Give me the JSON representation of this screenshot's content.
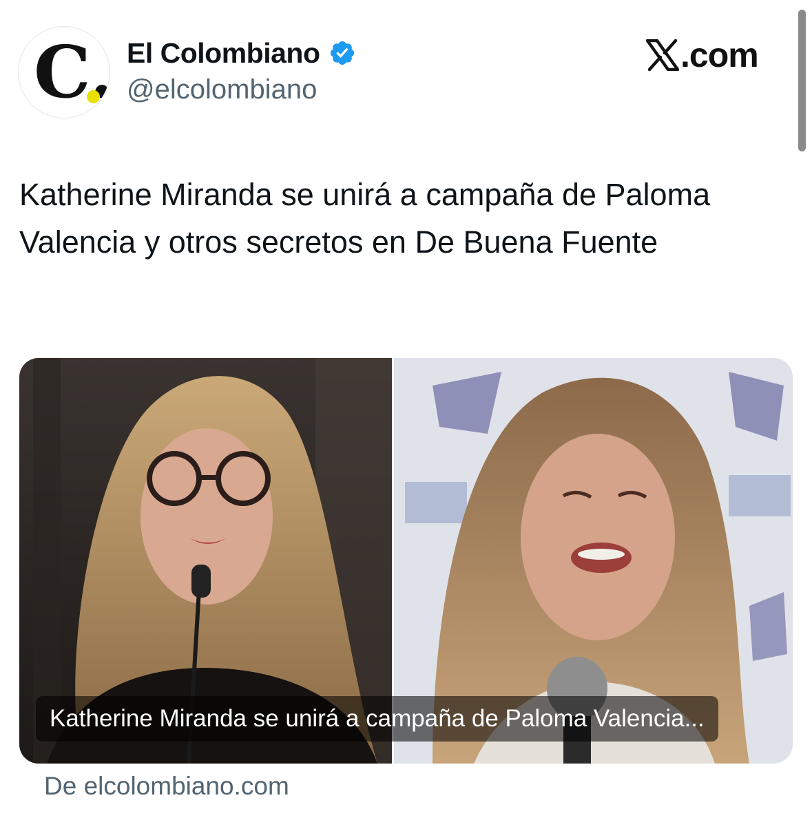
{
  "account": {
    "name": "El Colombiano",
    "handle": "@elcolombiano",
    "avatar_letter": "C.",
    "verified": true,
    "verified_badge_color": "#1d9bf0",
    "logo_dot_color": "#e8e000"
  },
  "brand": {
    "label": ".com",
    "icon": "x-logo-icon"
  },
  "tweet": {
    "text": "Katherine Miranda se unirá a campaña de Paloma Valencia y otros secretos en De Buena Fuente"
  },
  "link_card": {
    "caption": "Katherine Miranda se unirá a campaña de Paloma Valencia...",
    "source": "De elcolombiano.com"
  },
  "colors": {
    "text_primary": "#0f1419",
    "text_secondary": "#536471"
  }
}
